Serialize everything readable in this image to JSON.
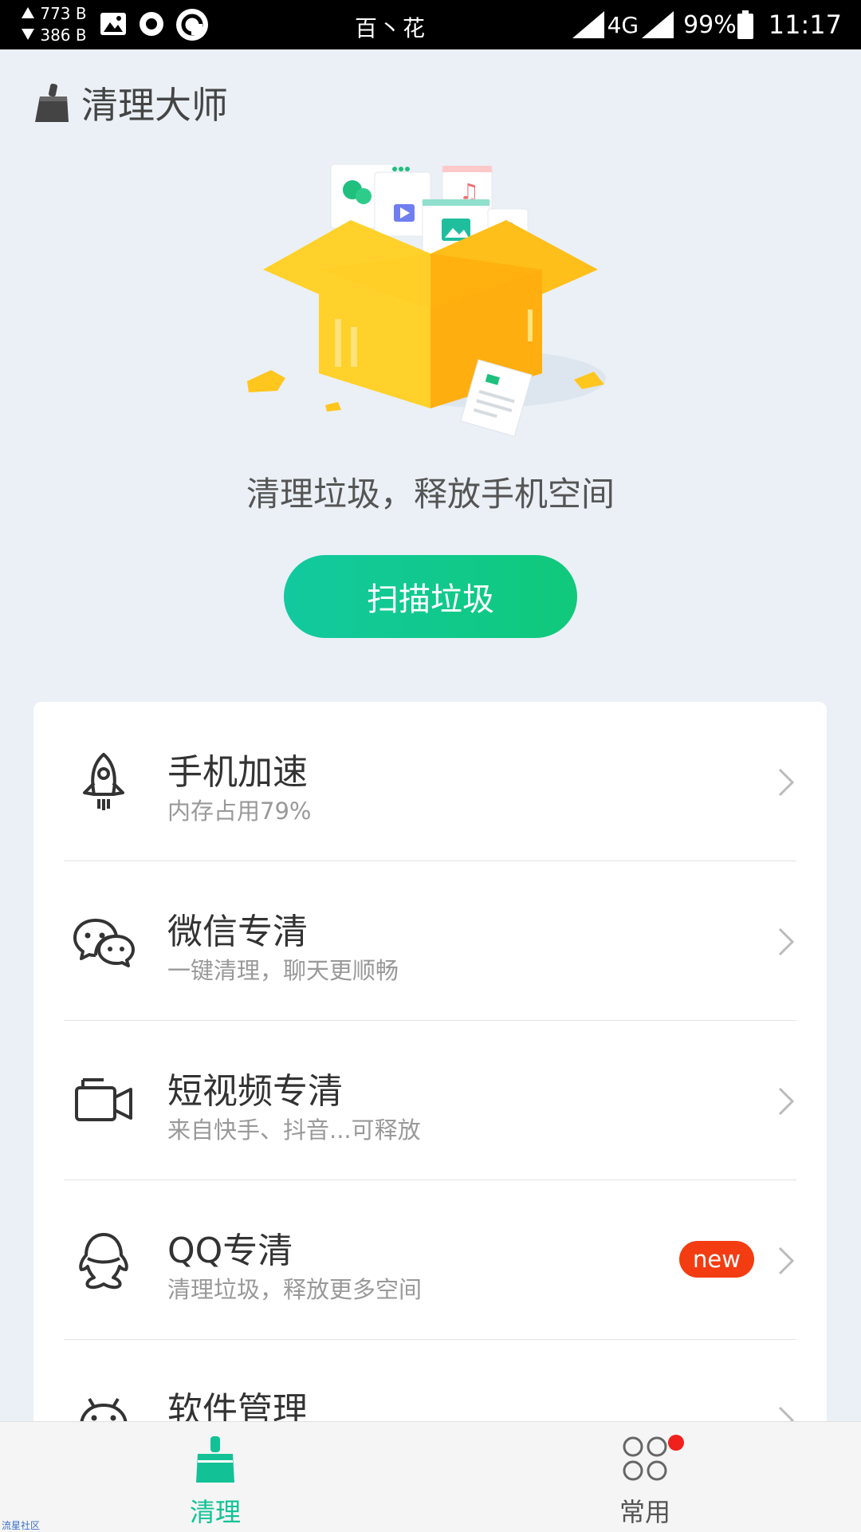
{
  "status_bar": {
    "upload_rate": "773 B",
    "download_rate": "386 B",
    "carrier": "百丶花",
    "network_type": "4G",
    "battery_percent": "99%",
    "time": "11:17",
    "icons": [
      "up-arrow-icon",
      "down-arrow-icon",
      "image-icon",
      "circle-icon",
      "refresh-icon",
      "signal-icon",
      "battery-icon"
    ]
  },
  "header": {
    "app_title": "清理大师",
    "icon": "broom-icon"
  },
  "hero": {
    "tagline": "清理垃圾，释放手机空间",
    "scan_button": "扫描垃圾",
    "accent_color": "#12c996"
  },
  "features": [
    {
      "title": "手机加速",
      "subtitle": "内存占用79%",
      "icon": "rocket-icon"
    },
    {
      "title": "微信专清",
      "subtitle": "一键清理，聊天更顺畅",
      "icon": "wechat-icon"
    },
    {
      "title": "短视频专清",
      "subtitle": "来自快手、抖音...可释放",
      "icon": "video-camera-icon"
    },
    {
      "title": "QQ专清",
      "subtitle": "清理垃圾，释放更多空间",
      "icon": "qq-icon",
      "badge": "new",
      "badge_color": "#f43c12"
    },
    {
      "title": "软件管理",
      "subtitle": "",
      "icon": "android-icon"
    }
  ],
  "bottom_nav": {
    "tabs": [
      {
        "label": "清理",
        "icon": "broom-icon",
        "active": true
      },
      {
        "label": "常用",
        "icon": "apps-grid-icon",
        "active": false,
        "has_notification_dot": true
      }
    ]
  },
  "watermark": "流星社区"
}
